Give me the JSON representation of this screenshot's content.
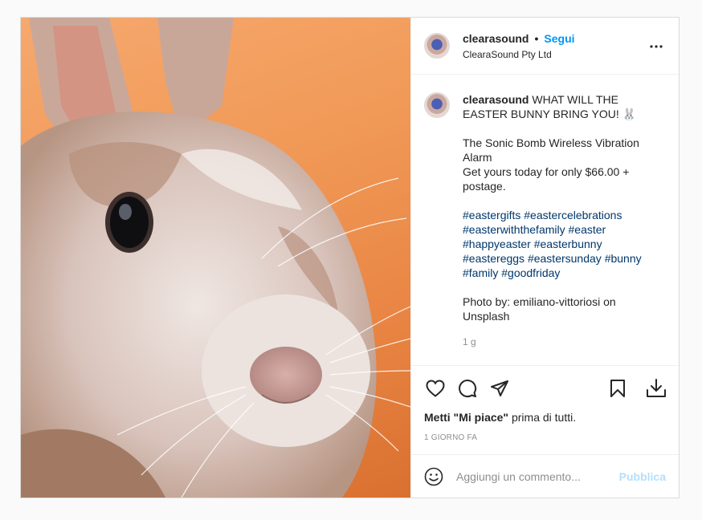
{
  "post": {
    "photo_alt": "",
    "header": {
      "username": "clearasound",
      "separator": "•",
      "follow_label": "Segui",
      "location": "ClearaSound Pty Ltd"
    },
    "caption": {
      "username": "clearasound",
      "text": "WHAT WILL THE EASTER BUNNY BRING YOU! 🐰\n\nThe Sonic Bomb Wireless Vibration Alarm\nGet yours today for only $66.00 + postage.",
      "hashtags": [
        "#eastergifts",
        "#eastercelebrations",
        "#easterwiththefamily",
        "#easter",
        "#happyeaster",
        "#easterbunny",
        "#eastereggs",
        "#eastersunday",
        "#bunny",
        "#family",
        "#goodfriday"
      ],
      "credit": "Photo by: emiliano-vittoriosi on Unsplash",
      "time": "1 g"
    },
    "likes": {
      "bold": "Metti \"Mi piace\"",
      "rest": " prima di tutti."
    },
    "posted_ago": "1 GIORNO FA",
    "comment": {
      "placeholder": "Aggiungi un commento...",
      "publish_label": "Pubblica"
    },
    "icons": {
      "more": "more-horizontal-icon",
      "like": "heart-icon",
      "comment": "comment-bubble-icon",
      "share": "paper-plane-icon",
      "save": "bookmark-icon",
      "download": "download-icon",
      "emoji": "smiley-icon"
    },
    "colors": {
      "accent": "#0095f6",
      "hashtag": "#00376b",
      "muted": "#8e8e8e",
      "publish_disabled": "#b2dffc"
    }
  }
}
